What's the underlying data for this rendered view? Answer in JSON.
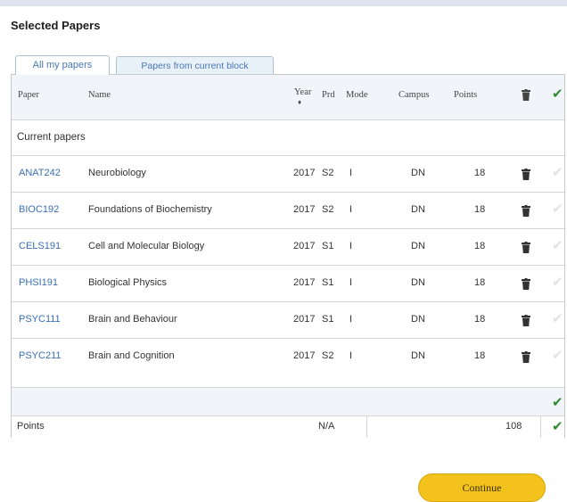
{
  "page": {
    "title": "Selected Papers"
  },
  "tabs": [
    {
      "label": "All my papers",
      "active": true
    },
    {
      "label": "Papers from current block",
      "active": false
    }
  ],
  "table": {
    "headers": {
      "paper": "Paper",
      "name": "Name",
      "year": "Year",
      "year_sort": "♦",
      "prd": "Prd",
      "mode": "Mode",
      "campus": "Campus",
      "points": "Points"
    },
    "section_label": "Current papers",
    "rows": [
      {
        "code": "ANAT242",
        "name": "Neurobiology",
        "year": "2017",
        "prd": "S2",
        "mode": "I",
        "campus": "DN",
        "points": "18"
      },
      {
        "code": "BIOC192",
        "name": "Foundations of Biochemistry",
        "year": "2017",
        "prd": "S2",
        "mode": "I",
        "campus": "DN",
        "points": "18"
      },
      {
        "code": "CELS191",
        "name": "Cell and Molecular Biology",
        "year": "2017",
        "prd": "S1",
        "mode": "I",
        "campus": "DN",
        "points": "18"
      },
      {
        "code": "PHSI191",
        "name": "Biological Physics",
        "year": "2017",
        "prd": "S1",
        "mode": "I",
        "campus": "DN",
        "points": "18"
      },
      {
        "code": "PSYC111",
        "name": "Brain and Behaviour",
        "year": "2017",
        "prd": "S1",
        "mode": "I",
        "campus": "DN",
        "points": "18"
      },
      {
        "code": "PSYC211",
        "name": "Brain and Cognition",
        "year": "2017",
        "prd": "S2",
        "mode": "I",
        "campus": "DN",
        "points": "18"
      }
    ],
    "totals": {
      "label": "Points",
      "year_value": "N/A",
      "points_value": "108"
    }
  },
  "icons": {
    "trash": "trash-icon",
    "check": "check-icon"
  },
  "colors": {
    "link": "#3a6fb4",
    "check_green": "#2f8a2f",
    "button": "#f4c21c"
  },
  "actions": {
    "continue_label": "Continue"
  }
}
